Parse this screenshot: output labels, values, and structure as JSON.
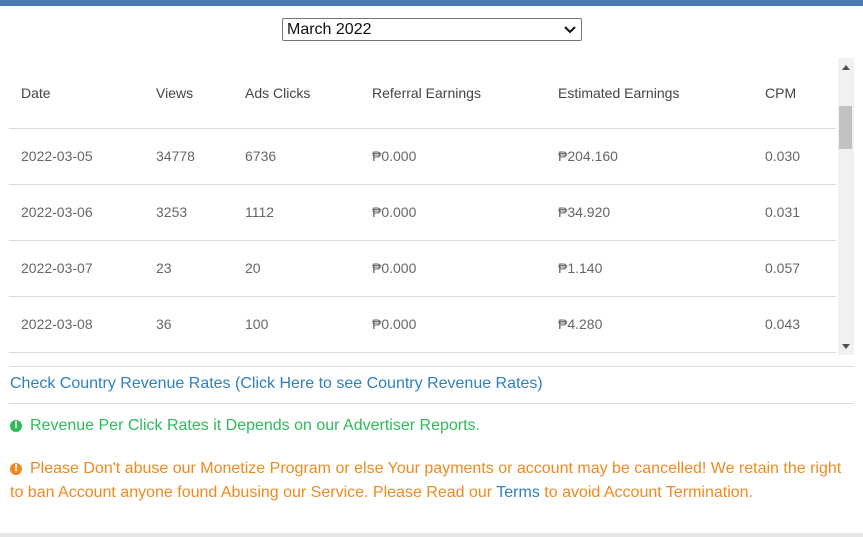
{
  "month_select": {
    "selected": "March 2022"
  },
  "table": {
    "headers": [
      "Date",
      "Views",
      "Ads Clicks",
      "Referral Earnings",
      "Estimated Earnings",
      "CPM"
    ],
    "rows": [
      [
        "2022-03-05",
        "34778",
        "6736",
        "₱0.000",
        "₱204.160",
        "0.030"
      ],
      [
        "2022-03-06",
        "3253",
        "1112",
        "₱0.000",
        "₱34.920",
        "0.031"
      ],
      [
        "2022-03-07",
        "23",
        "20",
        "₱0.000",
        "₱1.140",
        "0.057"
      ],
      [
        "2022-03-08",
        "36",
        "100",
        "₱0.000",
        "₱4.280",
        "0.043"
      ]
    ]
  },
  "rates_link": "Check Country Revenue Rates (Click Here to see Country Revenue Rates)",
  "notes": {
    "green": "Revenue Per Click Rates it Depends on our Advertiser Reports.",
    "orange_before": "Please Don't abuse our Monetize Program or else Your payments or account may be cancelled! We retain the right to ban Account anyone found Abusing our Service. Please Read our ",
    "orange_link": "Terms",
    "orange_after": " to avoid Account Termination."
  },
  "icons": {
    "select_chevron": "chevron-down-icon",
    "scroll_up": "triangle-up-icon",
    "scroll_down": "triangle-down-icon",
    "note_green": "info-circle-icon",
    "note_orange": "alert-circle-icon"
  },
  "colors": {
    "top_bar": "#4a7bb0",
    "link": "#2f80c0",
    "green": "#2ebc5a",
    "orange": "#f08a1e"
  }
}
